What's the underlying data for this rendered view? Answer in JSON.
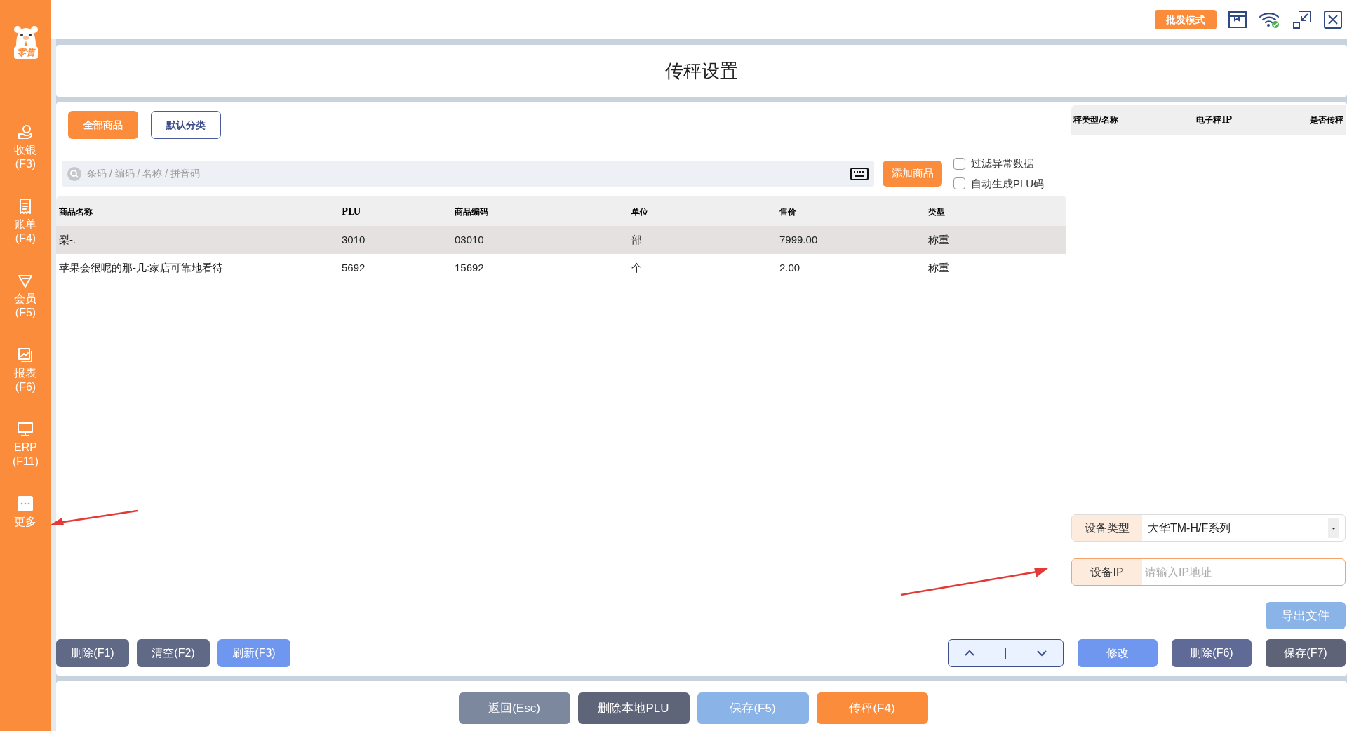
{
  "sidebar": {
    "logo_text": "零售",
    "items": [
      {
        "kind": "cashier",
        "label": "收银",
        "shortcut": "(F3)"
      },
      {
        "kind": "bill",
        "label": "账单",
        "shortcut": "(F4)"
      },
      {
        "kind": "member",
        "label": "会员",
        "shortcut": "(F5)"
      },
      {
        "kind": "report",
        "label": "报表",
        "shortcut": "(F6)"
      },
      {
        "kind": "erp",
        "label": "ERP",
        "shortcut": "(F11)"
      },
      {
        "kind": "more",
        "label": "更多"
      }
    ]
  },
  "top_bar": {
    "mode_button": "批发模式"
  },
  "title": "传秤设置",
  "category_tabs": [
    {
      "label": "全部商品",
      "selected": true
    },
    {
      "label": "默认分类",
      "selected": false
    }
  ],
  "search": {
    "placeholder": "条码 / 编码 / 名称 / 拼音码"
  },
  "add_button": "添加商品",
  "options": [
    {
      "label": "过滤异常数据",
      "checked": false
    },
    {
      "label": "自动生成PLU码",
      "checked": false
    }
  ],
  "product_table": {
    "columns": [
      "商品名称",
      "PLU",
      "商品编码",
      "单位",
      "售价",
      "类型"
    ],
    "rows": [
      {
        "selected": true,
        "cells": [
          "梨-.",
          "3010",
          "03010",
          "部",
          "7999.00",
          "称重"
        ]
      },
      {
        "selected": false,
        "cells": [
          "苹果会很呢的那-几:家店可靠地看待",
          "5692",
          "15692",
          "个",
          "2.00",
          "称重"
        ]
      }
    ]
  },
  "scale_table": {
    "columns": [
      "秤类型/名称",
      "电子秤IP",
      "是否传秤"
    ]
  },
  "device_form": {
    "type_label": "设备类型",
    "type_value": "大华TM-H/F系列",
    "ip_label": "设备IP",
    "ip_placeholder": "请输入IP地址"
  },
  "export_button": "导出文件",
  "left_buttons": [
    {
      "label": "删除(F1)",
      "color": "#606a87"
    },
    {
      "label": "清空(F2)",
      "color": "#606a87"
    },
    {
      "label": "刷新(F3)",
      "color": "#6f97ef"
    }
  ],
  "right_buttons": [
    {
      "label": "修改",
      "color": "#6f97ef"
    },
    {
      "label": "删除(F6)",
      "color": "#606a96"
    },
    {
      "label": "保存(F7)",
      "color": "#5f6378"
    }
  ],
  "bottom_buttons": [
    {
      "label": "返回(Esc)",
      "color": "#7b889e"
    },
    {
      "label": "删除本地PLU",
      "color": "#5f6578"
    },
    {
      "label": "保存(F5)",
      "color": "#8ab4e8"
    },
    {
      "label": "传秤(F4)",
      "color": "#fb8c3b"
    }
  ]
}
